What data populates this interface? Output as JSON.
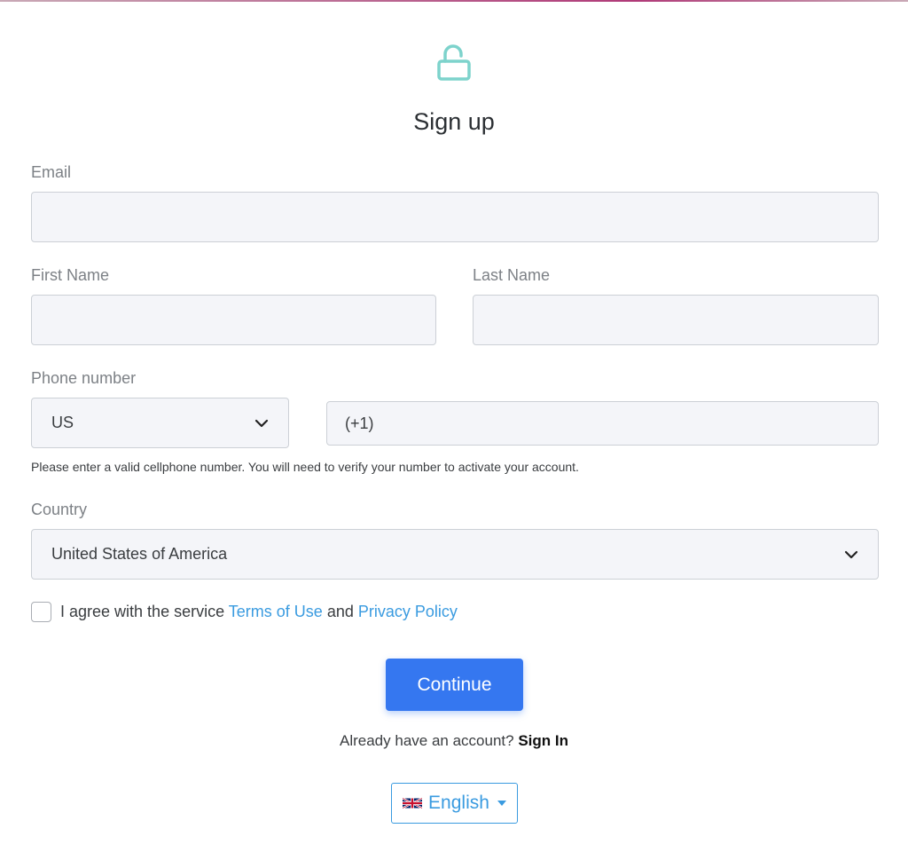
{
  "form": {
    "title": "Sign up",
    "email_label": "Email",
    "email_value": "",
    "first_name_label": "First Name",
    "first_name_value": "",
    "last_name_label": "Last Name",
    "last_name_value": "",
    "phone_label": "Phone number",
    "phone_country_code": "US",
    "phone_value": "(+1)",
    "phone_help": "Please enter a valid cellphone number. You will need to verify your number to activate your account.",
    "country_label": "Country",
    "country_value": "United States of America",
    "agree_text": "I agree with the service",
    "terms_link": "Terms of Use",
    "and_text": "and",
    "privacy_link": "Privacy Policy",
    "continue_label": "Continue",
    "already_text": "Already have an account?",
    "signin_link": "Sign In"
  },
  "language": {
    "label": "English",
    "flag_icon": "uk-flag-icon"
  },
  "icons": {
    "lock": "unlocked-lock-icon",
    "chevron": "chevron-down-icon"
  },
  "colors": {
    "accent_teal": "#7dd3cc",
    "primary_blue": "#3577f0",
    "link_blue": "#3a9be0"
  }
}
